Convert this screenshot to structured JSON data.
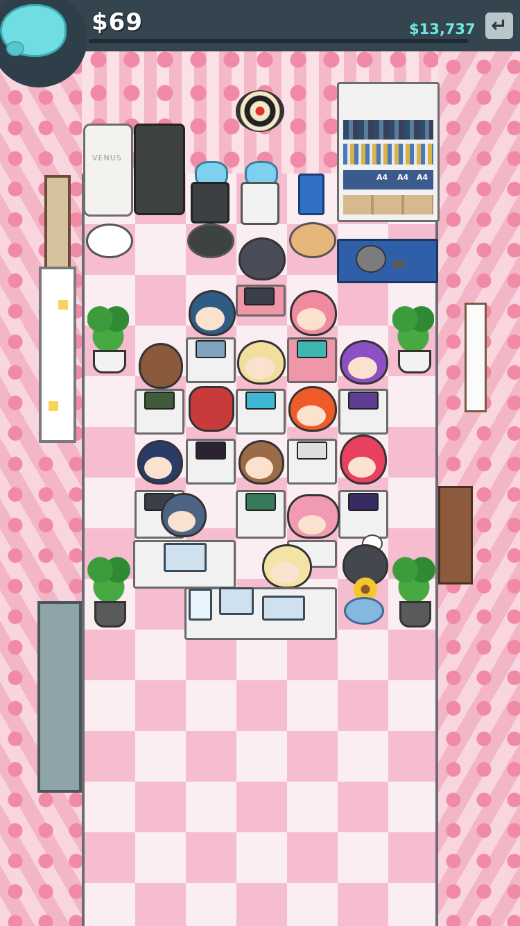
{
  "hud": {
    "cash": "$69",
    "total_money": "$13,737",
    "exit_icon": "exit-arrow-icon",
    "mascot_icon": "piggy-bank-icon",
    "colors": {
      "hud_bg": "#34454f",
      "total_text": "#6fe7e2",
      "cash_text": "#ffffff"
    }
  },
  "office": {
    "fridge_label": "VENUS",
    "shelf_binder_labels": [
      "A4",
      "A4",
      "A4"
    ],
    "workers_count": 17
  }
}
